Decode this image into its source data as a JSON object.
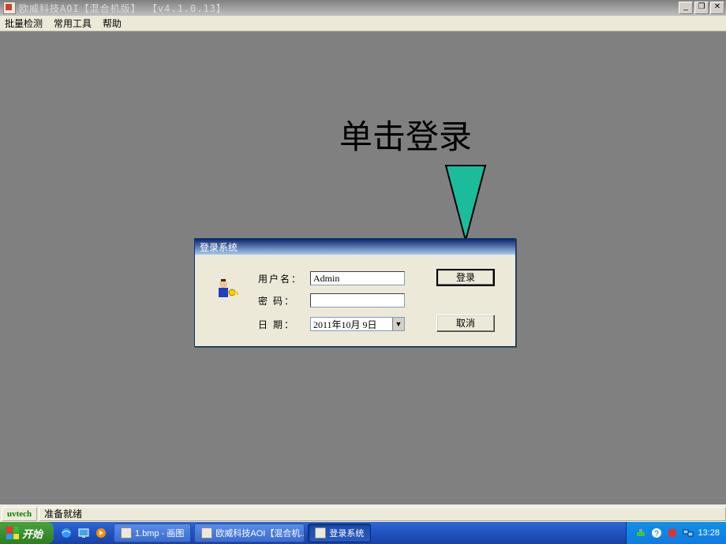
{
  "window": {
    "title": "欧威科技AOI【混合机版】 【v4.1.0.13】",
    "minimize": "_",
    "restore": "❐",
    "close": "✕"
  },
  "menu": {
    "items": [
      "批量检测",
      "常用工具",
      "帮助"
    ]
  },
  "annotation": {
    "text": "单击登录"
  },
  "dialog": {
    "title": "登录系统",
    "username_label": "用户名：",
    "username_value": "Admin",
    "password_label": "密  码：",
    "password_value": "",
    "date_label": "日  期：",
    "date_value": "2011年10月 9日",
    "login_btn": "登录",
    "cancel_btn": "取消"
  },
  "status": {
    "brand": "uvtech",
    "msg": "准备就绪"
  },
  "taskbar": {
    "start": "开始",
    "tasks": [
      {
        "label": "1.bmp - 画图"
      },
      {
        "label": "欧威科技AOI【混合机..."
      },
      {
        "label": "登录系统"
      }
    ],
    "clock": "13:28"
  }
}
